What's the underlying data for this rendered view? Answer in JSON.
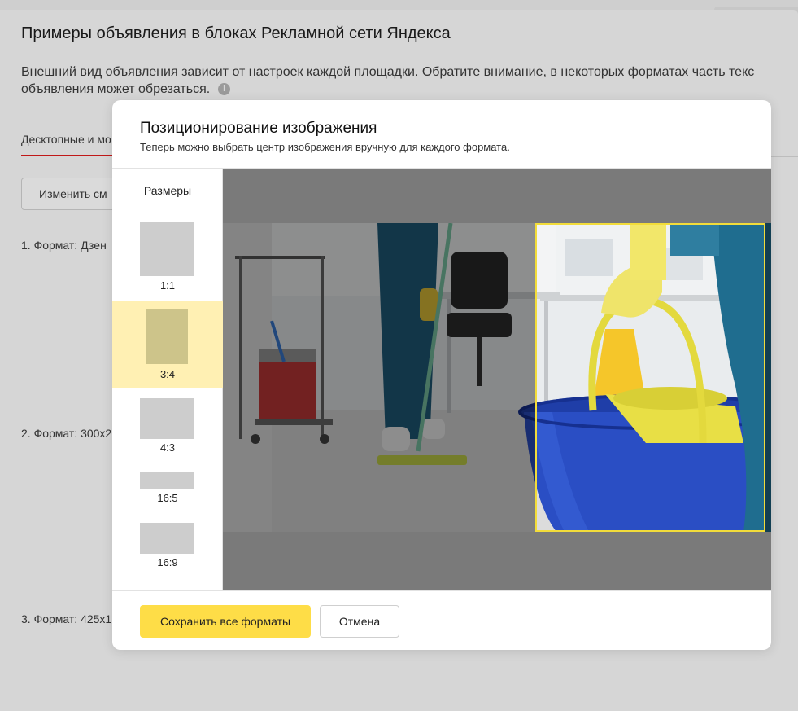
{
  "page": {
    "title": "Примеры объявления в блоках Рекламной сети Яндекса",
    "description_line1": "Внешний вид объявления зависит от настроек каждой площадки. Обратите внимание, в некоторых форматах часть текс",
    "description_line2": "объявления может обрезаться.",
    "info_icon_glyph": "i",
    "tab_label": "Десктопные и мо",
    "change_button_label": "Изменить см",
    "formats": [
      {
        "label": "1. Формат: Дзен"
      },
      {
        "label": "2. Формат: 300x2"
      },
      {
        "label": "3. Формат: 425x1"
      }
    ]
  },
  "modal": {
    "title": "Позиционирование изображения",
    "subtitle": "Теперь можно выбрать центр изображения вручную для каждого формата.",
    "sizes_label": "Размеры",
    "sizes": [
      {
        "ratio": "1:1",
        "active": false
      },
      {
        "ratio": "3:4",
        "active": true
      },
      {
        "ratio": "4:3",
        "active": false
      },
      {
        "ratio": "16:5",
        "active": false
      },
      {
        "ratio": "16:9",
        "active": false
      }
    ],
    "save_label": "Сохранить все форматы",
    "cancel_label": "Отмена"
  },
  "colors": {
    "accent_yellow": "#fedd47",
    "active_size_bg": "#fff0b3",
    "crop_frame": "#f2dc3a",
    "tab_underline": "#c01818"
  }
}
